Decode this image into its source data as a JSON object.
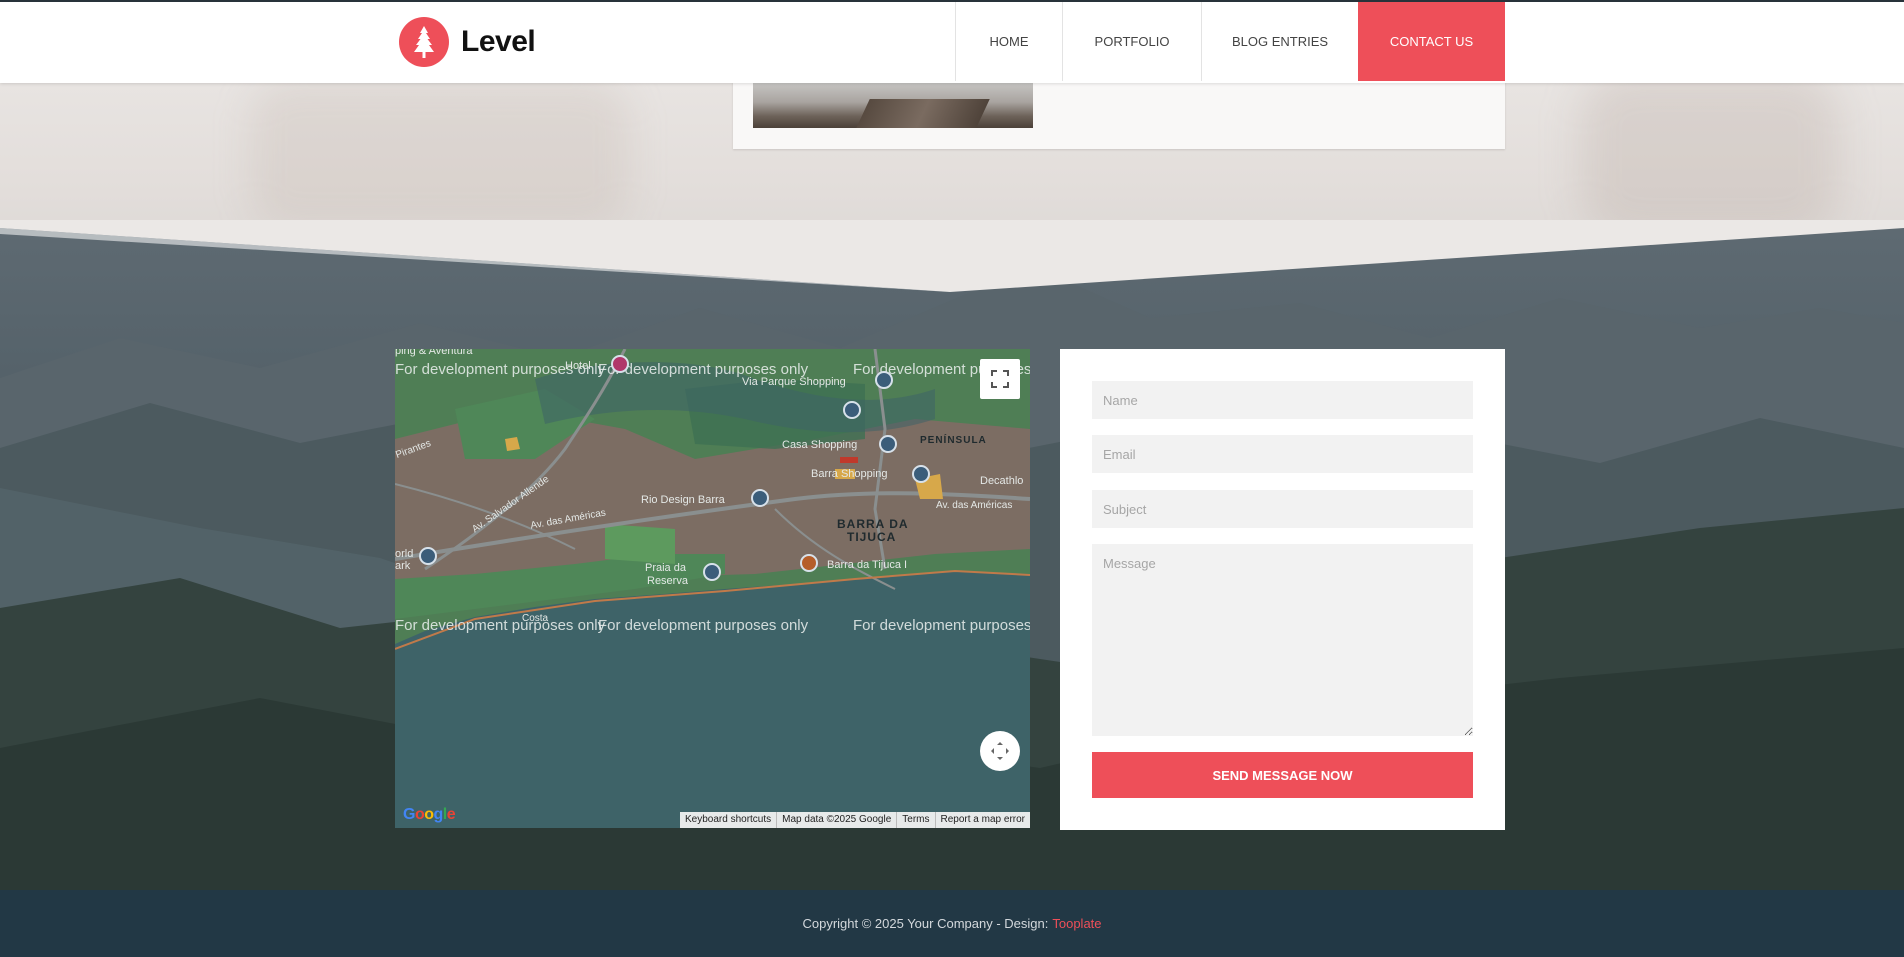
{
  "brand": {
    "name": "Level",
    "logo_icon": "tree-icon",
    "accent_color": "#ee4f59"
  },
  "nav": {
    "items": [
      {
        "label": "HOME"
      },
      {
        "label": "PORTFOLIO"
      },
      {
        "label": "BLOG ENTRIES"
      },
      {
        "label": "CONTACT US",
        "active": true
      }
    ]
  },
  "map": {
    "watermark": "For development purposes only",
    "labels": {
      "via_parque": "Via Parque Shopping",
      "casa_shopping": "Casa Shopping",
      "peninsula": "PENÍNSULA",
      "barra_shopping": "Barra Shopping",
      "decathlon": "Decathlo",
      "rio_design": "Rio Design Barra",
      "barra_tijuca_1": "BARRA DA",
      "barra_tijuca_2": "TIJUCA",
      "av_americas_1": "Av. das Américas",
      "av_americas_2": "Av. das Américas",
      "av_salvador": "Av. Salvador Allende",
      "praia_1": "Praia da",
      "praia_2": "Reserva",
      "barra_tijuca_place": "Barra da Tijuca I",
      "hotel": "Hotel",
      "pirantes": "Pirantes",
      "aventura": "ping & Aventura",
      "orld_1": "orld",
      "orld_2": "ark",
      "costa": "Costa"
    },
    "footer": {
      "shortcuts": "Keyboard shortcuts",
      "map_data": "Map data ©2025 Google",
      "terms": "Terms",
      "report": "Report a map error"
    },
    "google_logo": "Google"
  },
  "contact_form": {
    "name_placeholder": "Name",
    "email_placeholder": "Email",
    "subject_placeholder": "Subject",
    "message_placeholder": "Message",
    "send_label": "SEND MESSAGE NOW"
  },
  "footer": {
    "copyright": "Copyright © 2025 Your Company - Design:",
    "link_label": "Tooplate"
  }
}
